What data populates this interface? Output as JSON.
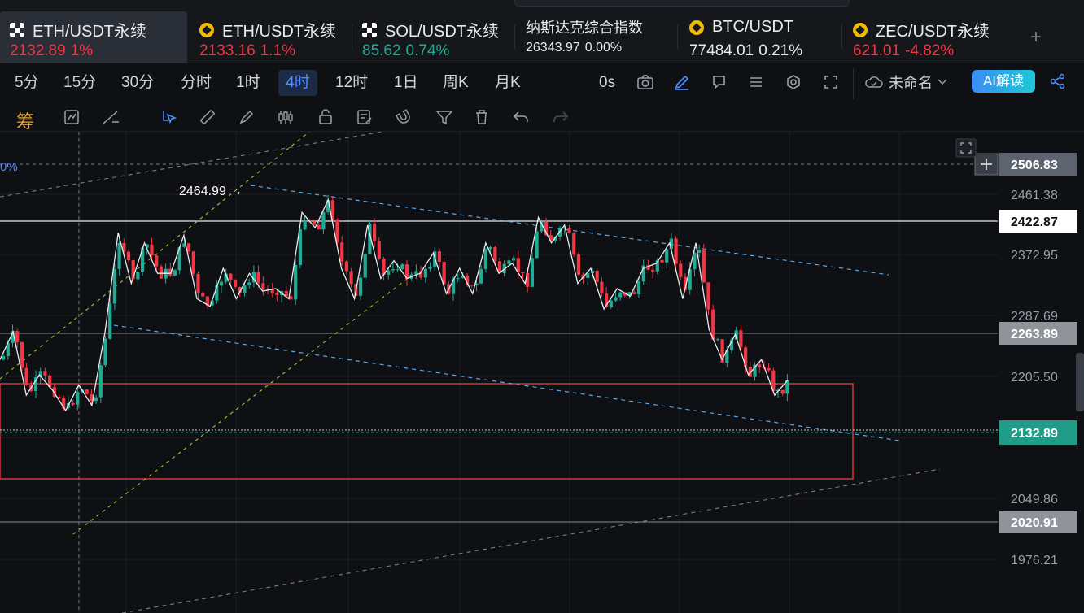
{
  "tickers": [
    {
      "name": "ETH/USDT永续",
      "price": "2132.89",
      "change": "1%",
      "trend": "down",
      "icon": "okx-icon",
      "active": true
    },
    {
      "name": "ETH/USDT永续",
      "price": "2133.16",
      "change": "1.1%",
      "trend": "down",
      "icon": "binance-icon"
    },
    {
      "name": "SOL/USDT永续",
      "price": "85.62",
      "change": "0.74%",
      "trend": "up",
      "icon": "okx-icon"
    },
    {
      "name": "纳斯达克综合指数",
      "price": "26343.97",
      "change": "0.00%",
      "trend": "flat",
      "icon": ""
    },
    {
      "name": "BTC/USDT",
      "price": "77484.01",
      "change": "0.21%",
      "trend": "flat",
      "icon": "binance-icon"
    },
    {
      "name": "ZEC/USDT永续",
      "price": "621.01",
      "change": "-4.82%",
      "trend": "down",
      "icon": "binance-icon"
    }
  ],
  "add_tab": "+",
  "intervals": [
    "5分",
    "15分",
    "30分",
    "分时",
    "1时",
    "4时",
    "12时",
    "1日",
    "周K",
    "月K"
  ],
  "active_interval": "4时",
  "countdown": "0s",
  "layout_name": "未命名",
  "ai_label": "AI解读",
  "chip_label": "筹",
  "chart_data": {
    "type": "candlestick",
    "symbol": "ETH/USDT永续",
    "interval": "4时",
    "y_ticks": [
      "2461.38",
      "2372.95",
      "2287.69",
      "2205.50",
      "2049.86",
      "1976.21"
    ],
    "price_labels": [
      {
        "value": "2506.83",
        "kind": "crosshair"
      },
      {
        "value": "2422.87",
        "kind": "horizontal-line"
      },
      {
        "value": "2263.89",
        "kind": "horizontal-line"
      },
      {
        "value": "2132.89",
        "kind": "last-price"
      },
      {
        "value": "2020.91",
        "kind": "horizontal-line"
      }
    ],
    "high_annotation": "2464.99",
    "crosshair_pct_label": "0%",
    "zigzag_pivots": [
      2150,
      2205,
      2080,
      2120,
      2090,
      2050,
      2100,
      2060,
      2205,
      2400,
      2300,
      2380,
      2320,
      2320,
      2395,
      2270,
      2255,
      2330,
      2270,
      2320,
      2285,
      2290,
      2270,
      2440,
      2410,
      2465,
      2330,
      2270,
      2415,
      2310,
      2345,
      2310,
      2320,
      2360,
      2280,
      2330,
      2280,
      2380,
      2320,
      2340,
      2300,
      2430,
      2380,
      2415,
      2300,
      2330,
      2250,
      2290,
      2275,
      2330,
      2340,
      2380,
      2270,
      2380,
      2210,
      2150,
      2200,
      2120,
      2150,
      2080,
      2110
    ]
  }
}
